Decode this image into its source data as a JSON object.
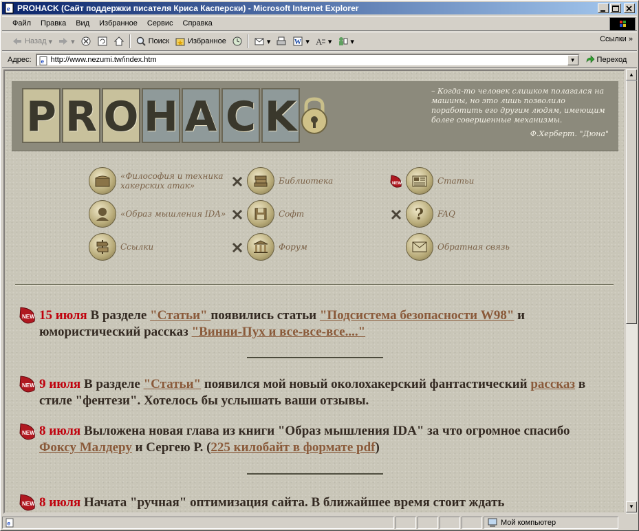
{
  "window": {
    "title": "PROHACK (Сайт поддержки писателя Криса Касперски) - Microsoft Internet Explorer"
  },
  "menu": [
    "Файл",
    "Правка",
    "Вид",
    "Избранное",
    "Сервис",
    "Справка"
  ],
  "toolbar": {
    "back": "Назад",
    "search": "Поиск",
    "favorites": "Избранное",
    "links": "Ссылки"
  },
  "address": {
    "label": "Адрес:",
    "url": "http://www.nezumi.tw/index.htm",
    "go": "Переход"
  },
  "banner": {
    "logo_letters": [
      "P",
      "R",
      "O",
      "H",
      "A",
      "C",
      "K"
    ],
    "quote": "– Когда-то человек слишком полагался на машины, но это лишь позволило поработить его другим людям, имеющим более совершенные механизмы.",
    "quote_author": "Ф.Херберт. \"Дюна\""
  },
  "nav": {
    "philosophy": "«Философия и техника хакерских атак»",
    "library": "Библиотека",
    "articles": "Статьи",
    "ida": "«Образ мышления IDA»",
    "soft": "Софт",
    "faq": "FAQ",
    "links": "Ссылки",
    "forum": "Форум",
    "feedback": "Обратная связь"
  },
  "news": [
    {
      "date": "15 июля",
      "t1": " В разделе ",
      "l1": "\"Статьи\" ",
      "t2": "появились статьи ",
      "l2": "\"Подсистема безопасности W98\"",
      "t3": " и юмористический рассказ ",
      "l3": "\"Винни-Пух и все-все-все....\""
    },
    {
      "date": "9 июля",
      "t1": " В разделе ",
      "l1": "\"Статьи\"",
      "t2": " появился мой новый околохакерский фантастический ",
      "l2": "рассказ",
      "t3": " в стиле \"фентези\". Хотелось бы услышать ваши отзывы."
    },
    {
      "date": "8 июля",
      "t1": " Выложена новая глава из книги \"Образ мышления IDA\" за что огромное спасибо ",
      "l1": "Фоксу Малдеру",
      "t2": " и Сергею Р. (",
      "l2": "225 килобайт в формате pdf",
      "t3": ")"
    },
    {
      "date": "8 июля",
      "t1": " Начата \"ручная\" оптимизация сайта. В ближайшее время стоит ждать"
    }
  ],
  "status": {
    "zone": "Мой компьютер"
  },
  "colors": {
    "title_gradient_start": "#0a246a",
    "date_red": "#c0000c",
    "link_brown": "#8a5a3a",
    "nav_text": "#7b6248"
  }
}
